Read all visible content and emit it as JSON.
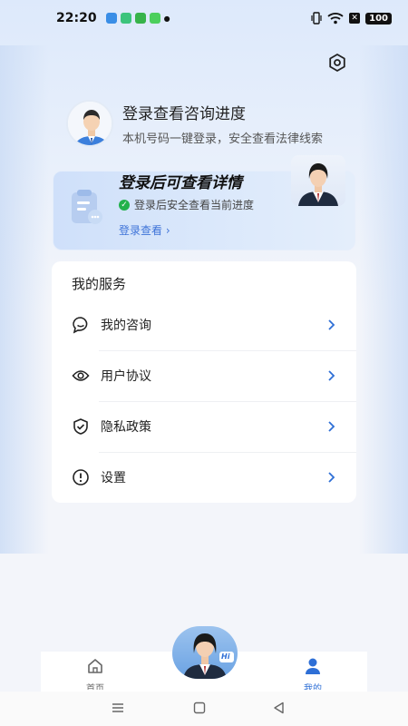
{
  "status_bar": {
    "time": "22:20",
    "battery": "100",
    "x_glyph": "✕"
  },
  "profile": {
    "title": "登录查看咨询进度",
    "subtitle": "本机号码一键登录，安全查看法律线索"
  },
  "banner": {
    "title": "登录后可查看详情",
    "check_text": "登录后安全查看当前进度",
    "link_text": "登录查看 ›"
  },
  "services": {
    "title": "我的服务",
    "items": [
      {
        "label": "我的咨询",
        "icon": "chat-bubble-icon"
      },
      {
        "label": "用户协议",
        "icon": "eye-icon"
      },
      {
        "label": "隐私政策",
        "icon": "shield-check-icon"
      },
      {
        "label": "设置",
        "icon": "info-circle-icon"
      }
    ]
  },
  "float_agent": {
    "badge": "Hi"
  },
  "tabs": [
    {
      "label": "首页",
      "icon": "home-icon",
      "active": false
    },
    {
      "label": "我的",
      "icon": "person-icon",
      "active": true
    }
  ],
  "colors": {
    "accent": "#2e6fd6",
    "check": "#22b14c",
    "link": "#3f74d8"
  }
}
